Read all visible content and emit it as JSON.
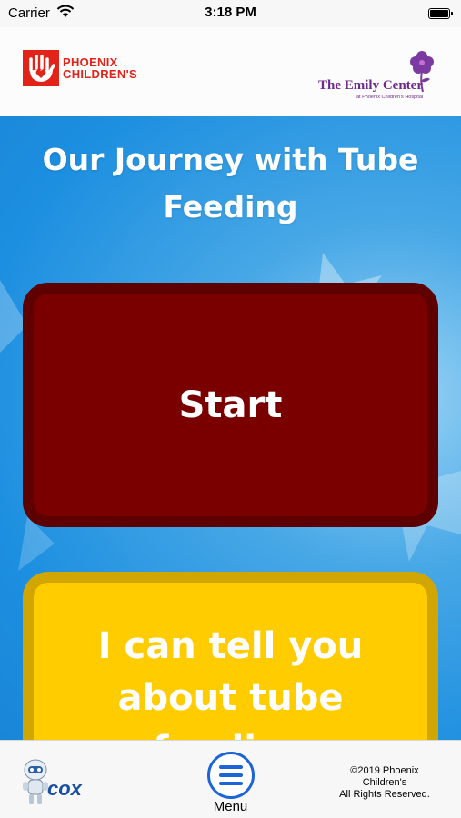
{
  "status_bar": {
    "carrier": "Carrier",
    "time": "3:18 PM"
  },
  "header": {
    "left_logo": {
      "line1": "PHOENIX",
      "line2": "CHILDREN'S"
    },
    "right_logo": {
      "name": "The Emily Center",
      "subtitle": "at Phoenix Children's Hospital"
    }
  },
  "main": {
    "title": "Our Journey with Tube Feeding",
    "start_button": "Start",
    "tell_button": "I can tell you about tube feeding"
  },
  "tabbar": {
    "sponsor_logo": "cox",
    "menu_label": "Menu",
    "copyright_lines": [
      "©2019 Phoenix",
      "Children's",
      "All Rights Reserved."
    ]
  },
  "colors": {
    "start_button": "#7a0000",
    "tell_button": "#ffcc00",
    "background": "#1d8fe0",
    "menu_accent": "#1c64d8",
    "brand_red": "#e2231a",
    "brand_purple": "#6d2a8a"
  }
}
